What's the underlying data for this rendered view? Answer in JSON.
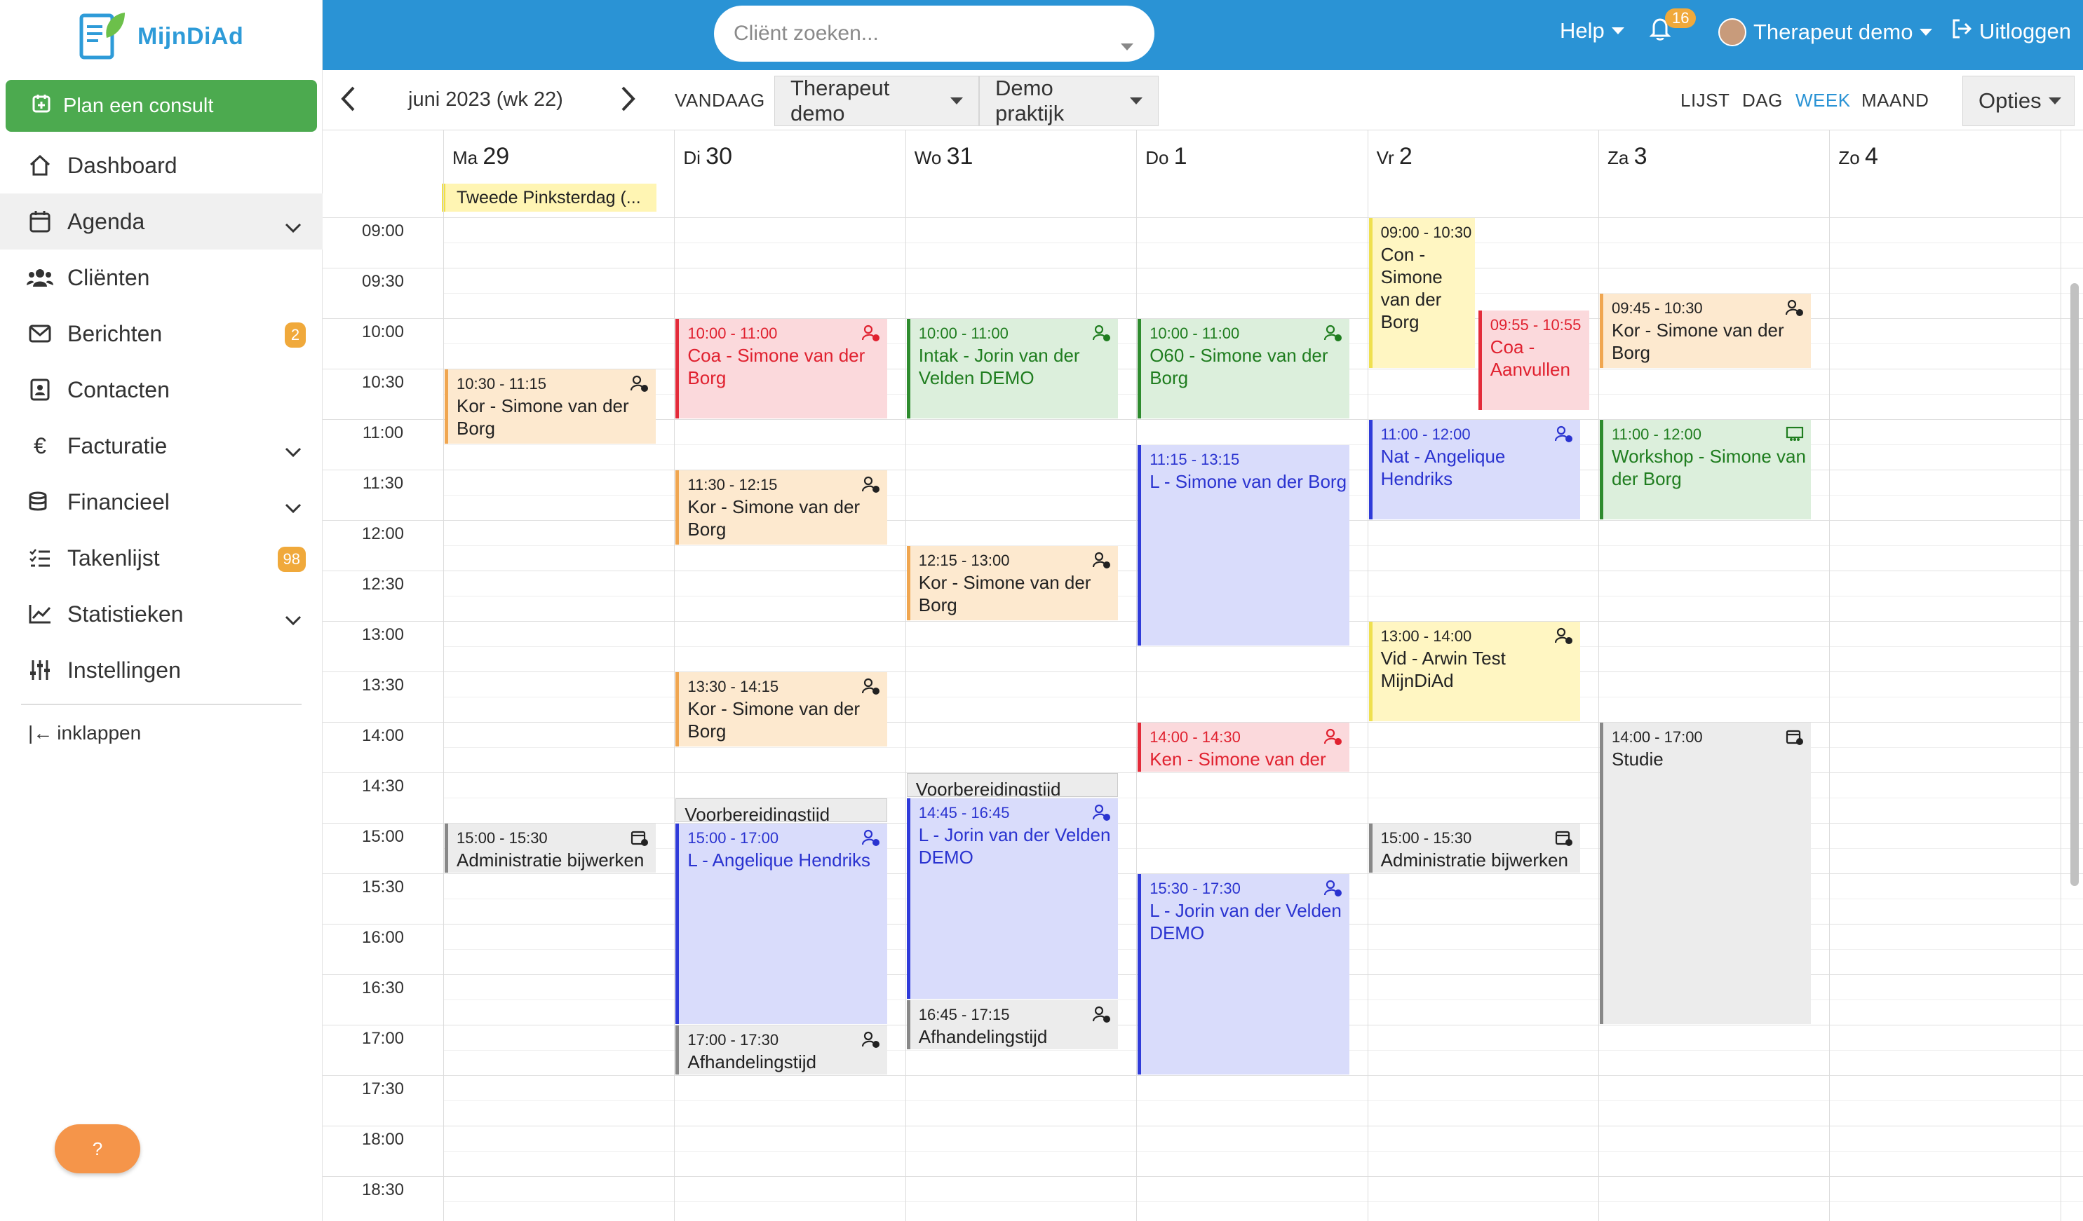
{
  "brand": {
    "name": "MijnDiAd"
  },
  "sidebar": {
    "plan_button": "Plan een consult",
    "items": [
      {
        "label": "Dashboard",
        "icon": "house-icon"
      },
      {
        "label": "Agenda",
        "icon": "calendar-icon"
      },
      {
        "label": "Cliënten",
        "icon": "users-icon"
      },
      {
        "label": "Berichten",
        "icon": "envelope-icon",
        "badge": "2"
      },
      {
        "label": "Contacten",
        "icon": "contact-card-icon"
      },
      {
        "label": "Facturatie",
        "icon": "euro-icon"
      },
      {
        "label": "Financieel",
        "icon": "coins-icon"
      },
      {
        "label": "Takenlijst",
        "icon": "list-icon",
        "badge": "98"
      },
      {
        "label": "Statistieken",
        "icon": "chart-icon"
      },
      {
        "label": "Instellingen",
        "icon": "sliders-icon"
      }
    ],
    "collapse": "inklappen",
    "help": "?"
  },
  "topbar": {
    "search_placeholder": "Cliënt zoeken...",
    "help": "Help",
    "notifications": "16",
    "user": "Therapeut demo",
    "logout": "Uitloggen"
  },
  "toolbar": {
    "period": "juni 2023 (wk 22)",
    "today": "VANDAAG",
    "therapist": "Therapeut demo",
    "practice": "Demo praktijk",
    "views": [
      "LIJST",
      "DAG",
      "WEEK",
      "MAAND"
    ],
    "active_view": "WEEK",
    "options": "Opties"
  },
  "calendar": {
    "days": [
      {
        "dow": "Ma",
        "num": "29"
      },
      {
        "dow": "Di",
        "num": "30"
      },
      {
        "dow": "Wo",
        "num": "31"
      },
      {
        "dow": "Do",
        "num": "1"
      },
      {
        "dow": "Vr",
        "num": "2"
      },
      {
        "dow": "Za",
        "num": "3"
      },
      {
        "dow": "Zo",
        "num": "4"
      }
    ],
    "holiday": "Tweede Pinksterdag (...",
    "times": [
      "09:00",
      "09:30",
      "10:00",
      "10:30",
      "11:00",
      "11:30",
      "12:00",
      "12:30",
      "13:00",
      "13:30",
      "14:00",
      "14:30",
      "15:00",
      "15:30",
      "16:00",
      "16:30",
      "17:00",
      "17:30",
      "18:00",
      "18:30"
    ],
    "events": [
      {
        "day": 0,
        "start": "10:30",
        "end": "11:15",
        "time": "10:30 - 11:15",
        "title": "Kor - Simone van der Borg",
        "color": "peach",
        "icon": "user-clock-icon"
      },
      {
        "day": 0,
        "start": "15:00",
        "end": "15:30",
        "time": "15:00 - 15:30",
        "title": "Administratie bijwerken",
        "color": "gray",
        "icon": "calendar-clock-icon"
      },
      {
        "day": 1,
        "start": "10:00",
        "end": "11:00",
        "time": "10:00 - 11:00",
        "title": "Coa - Simone van der Borg",
        "color": "red",
        "icon": "user-clock-icon"
      },
      {
        "day": 1,
        "start": "11:30",
        "end": "12:15",
        "time": "11:30 - 12:15",
        "title": "Kor - Simone van der Borg",
        "color": "peach",
        "icon": "user-clock-icon"
      },
      {
        "day": 1,
        "start": "13:30",
        "end": "14:15",
        "time": "13:30 - 14:15",
        "title": "Kor - Simone van der Borg",
        "color": "peach",
        "icon": "user-clock-icon"
      },
      {
        "day": 1,
        "start": "14:45",
        "end": "15:00",
        "time": "",
        "title": "Voorbereidingstijd",
        "color": "prep",
        "icon": ""
      },
      {
        "day": 1,
        "start": "15:00",
        "end": "17:00",
        "time": "15:00 - 17:00",
        "title": "L - Angelique Hendriks",
        "color": "blue",
        "icon": "user-clock-icon"
      },
      {
        "day": 1,
        "start": "17:00",
        "end": "17:30",
        "time": "17:00 - 17:30",
        "title": "Afhandelingstijd",
        "color": "gray",
        "icon": "user-clock-icon"
      },
      {
        "day": 2,
        "start": "10:00",
        "end": "11:00",
        "time": "10:00 - 11:00",
        "title": "Intak - Jorin van der Velden DEMO",
        "color": "green",
        "icon": "user-clock-icon"
      },
      {
        "day": 2,
        "start": "12:15",
        "end": "13:00",
        "time": "12:15 - 13:00",
        "title": "Kor - Simone van der Borg",
        "color": "peach",
        "icon": "user-clock-icon"
      },
      {
        "day": 2,
        "start": "14:30",
        "end": "14:45",
        "time": "",
        "title": "Voorbereidingstijd",
        "color": "prep",
        "icon": ""
      },
      {
        "day": 2,
        "start": "14:45",
        "end": "16:45",
        "time": "14:45 - 16:45",
        "title": "L - Jorin van der Velden DEMO",
        "color": "blue",
        "icon": "user-clock-icon"
      },
      {
        "day": 2,
        "start": "16:45",
        "end": "17:15",
        "time": "16:45 - 17:15",
        "title": "Afhandelingstijd",
        "color": "gray",
        "icon": "user-clock-icon"
      },
      {
        "day": 3,
        "start": "10:00",
        "end": "11:00",
        "time": "10:00 - 11:00",
        "title": "O60 - Simone van der Borg",
        "color": "green",
        "icon": "user-clock-icon"
      },
      {
        "day": 3,
        "start": "11:15",
        "end": "13:15",
        "time": "11:15 - 13:15",
        "title": "L - Simone van der Borg",
        "color": "blue",
        "icon": ""
      },
      {
        "day": 3,
        "start": "14:00",
        "end": "14:30",
        "time": "14:00 - 14:30",
        "title": "Ken - Simone van der",
        "color": "red",
        "icon": "user-clock-icon"
      },
      {
        "day": 3,
        "start": "15:30",
        "end": "17:30",
        "time": "15:30 - 17:30",
        "title": "L - Jorin van der Velden DEMO",
        "color": "blue",
        "icon": "user-clock-icon"
      },
      {
        "day": 4,
        "start": "09:00",
        "end": "10:30",
        "time": "09:00 - 10:30",
        "title": "Con - Simone van der Borg",
        "color": "yellow",
        "icon": "",
        "half": "left"
      },
      {
        "day": 4,
        "start": "09:55",
        "end": "10:55",
        "time": "09:55 - 10:55",
        "title": "Coa - Aanvullen",
        "color": "red",
        "icon": "",
        "half": "right"
      },
      {
        "day": 4,
        "start": "11:00",
        "end": "12:00",
        "time": "11:00 - 12:00",
        "title": "Nat - Angelique Hendriks",
        "color": "blue",
        "icon": "user-clock-icon"
      },
      {
        "day": 4,
        "start": "13:00",
        "end": "14:00",
        "time": "13:00 - 14:00",
        "title": "Vid - Arwin Test MijnDiAd",
        "color": "yellow",
        "icon": "user-clock-icon"
      },
      {
        "day": 4,
        "start": "15:00",
        "end": "15:30",
        "time": "15:00 - 15:30",
        "title": "Administratie bijwerken",
        "color": "gray",
        "icon": "calendar-clock-icon"
      },
      {
        "day": 5,
        "start": "09:45",
        "end": "10:30",
        "time": "09:45 - 10:30",
        "title": "Kor - Simone van der Borg",
        "color": "peach",
        "icon": "user-clock-icon"
      },
      {
        "day": 5,
        "start": "11:00",
        "end": "12:00",
        "time": "11:00 - 12:00",
        "title": "Workshop - Simone van der Borg",
        "color": "green",
        "icon": "presentation-icon"
      },
      {
        "day": 5,
        "start": "14:00",
        "end": "17:00",
        "time": "14:00 - 17:00",
        "title": "Studie",
        "color": "gray",
        "icon": "calendar-clock-icon"
      }
    ]
  }
}
